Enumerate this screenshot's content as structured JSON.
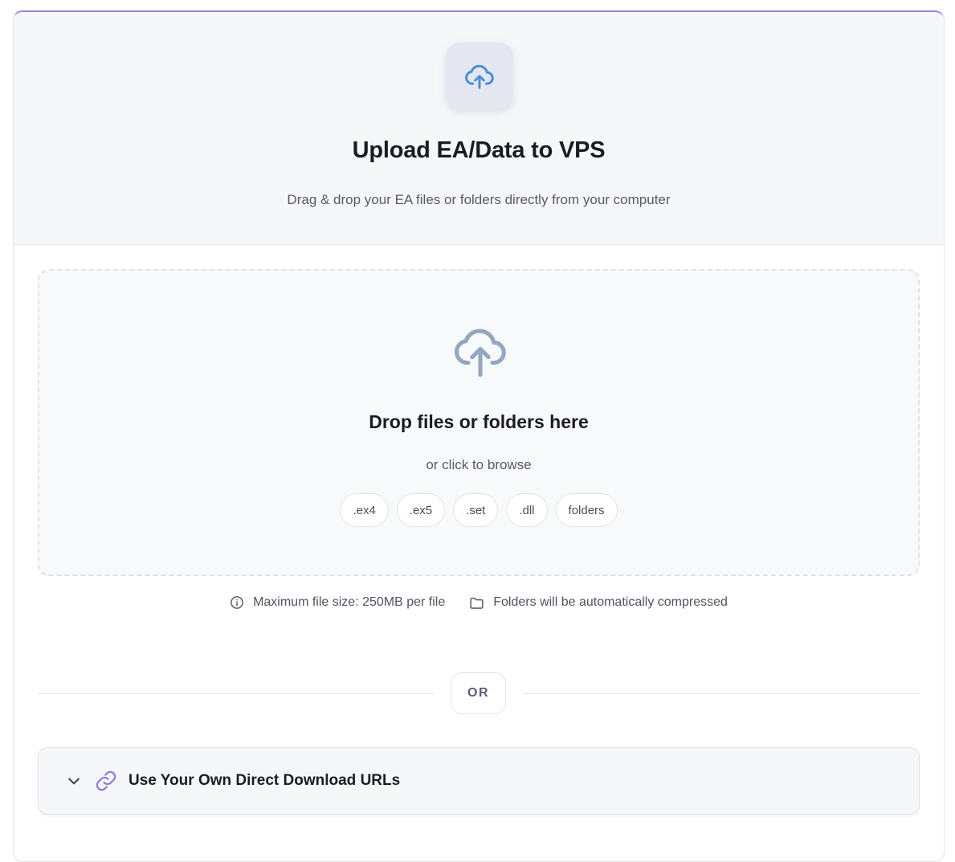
{
  "header": {
    "icon": "cloud-upload-icon",
    "title": "Upload EA/Data to VPS",
    "subtitle": "Drag & drop your EA files or folders directly from your computer"
  },
  "dropzone": {
    "icon": "cloud-upload-icon",
    "title": "Drop files or folders here",
    "subtitle": "or click to browse",
    "file_types": [
      ".ex4",
      ".ex5",
      ".set",
      ".dll",
      "folders"
    ]
  },
  "info": {
    "max_size": "Maximum file size: 250MB per file",
    "folders_note": "Folders will be automatically compressed"
  },
  "divider": {
    "label": "OR"
  },
  "url_section": {
    "title": "Use Your Own Direct Download URLs",
    "expanded": false
  },
  "colors": {
    "accent": "#8d85e8",
    "icon_blue": "#4a8fdc",
    "icon_muted": "#93a7c0",
    "link_purple": "#8a7fe0"
  }
}
